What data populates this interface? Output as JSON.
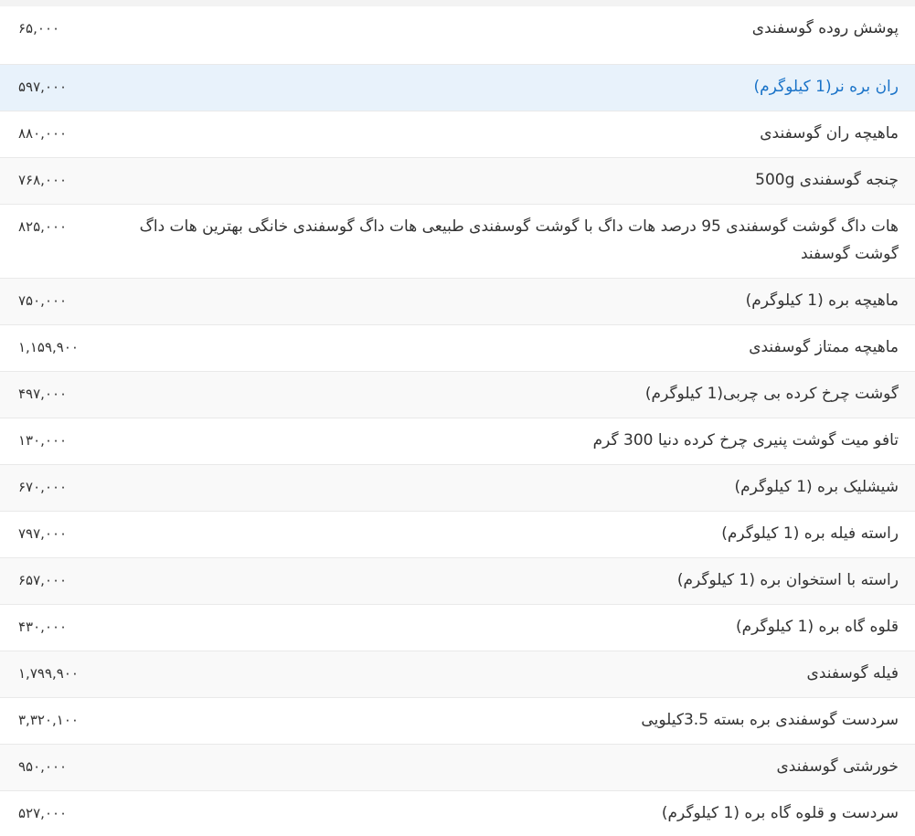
{
  "products": [
    {
      "name": "پوشش روده گوسفندی",
      "price": "۶۵,۰۰۰"
    },
    {
      "name": "ران بره نر(1 کیلوگرم)",
      "price": "۵۹۷,۰۰۰"
    },
    {
      "name": "ماهیچه ران گوسفندی",
      "price": "۸۸۰,۰۰۰"
    },
    {
      "name": "چنجه گوسفندی 500g",
      "price": "۷۶۸,۰۰۰"
    },
    {
      "name": "هات داگ گوشت گوسفندی 95 درصد هات داگ با گوشت گوسفندی طبیعی هات داگ گوسفندی خانگی بهترین هات داگ گوشت گوسفند",
      "price": "۸۲۵,۰۰۰"
    },
    {
      "name": "ماهیچه بره (1 کیلوگرم)",
      "price": "۷۵۰,۰۰۰"
    },
    {
      "name": "ماهیچه ممتاز گوسفندی",
      "price": "۱,۱۵۹,۹۰۰"
    },
    {
      "name": "گوشت چرخ کرده بی چربی(1 کیلوگرم)",
      "price": "۴۹۷,۰۰۰"
    },
    {
      "name": "تافو میت گوشت پنیری چرخ کرده دنیا 300 گرم",
      "price": "۱۳۰,۰۰۰"
    },
    {
      "name": "شیشلیک بره (1 کیلوگرم)",
      "price": "۶۷۰,۰۰۰"
    },
    {
      "name": "راسته فیله بره (1 کیلوگرم)",
      "price": "۷۹۷,۰۰۰"
    },
    {
      "name": "راسته با استخوان بره (1 کیلوگرم)",
      "price": "۶۵۷,۰۰۰"
    },
    {
      "name": "قلوه گاه بره (1 کیلوگرم)",
      "price": "۴۳۰,۰۰۰"
    },
    {
      "name": "فیله گوسفندی",
      "price": "۱,۷۹۹,۹۰۰"
    },
    {
      "name": "سردست گوسفندی بره بسته 3.5کیلویی",
      "price": "۳,۳۲۰,۱۰۰"
    },
    {
      "name": "خورشتی گوسفندی",
      "price": "۹۵۰,۰۰۰"
    },
    {
      "name": "سردست و قلوه گاه بره (1 کیلوگرم)",
      "price": "۵۲۷,۰۰۰"
    }
  ]
}
